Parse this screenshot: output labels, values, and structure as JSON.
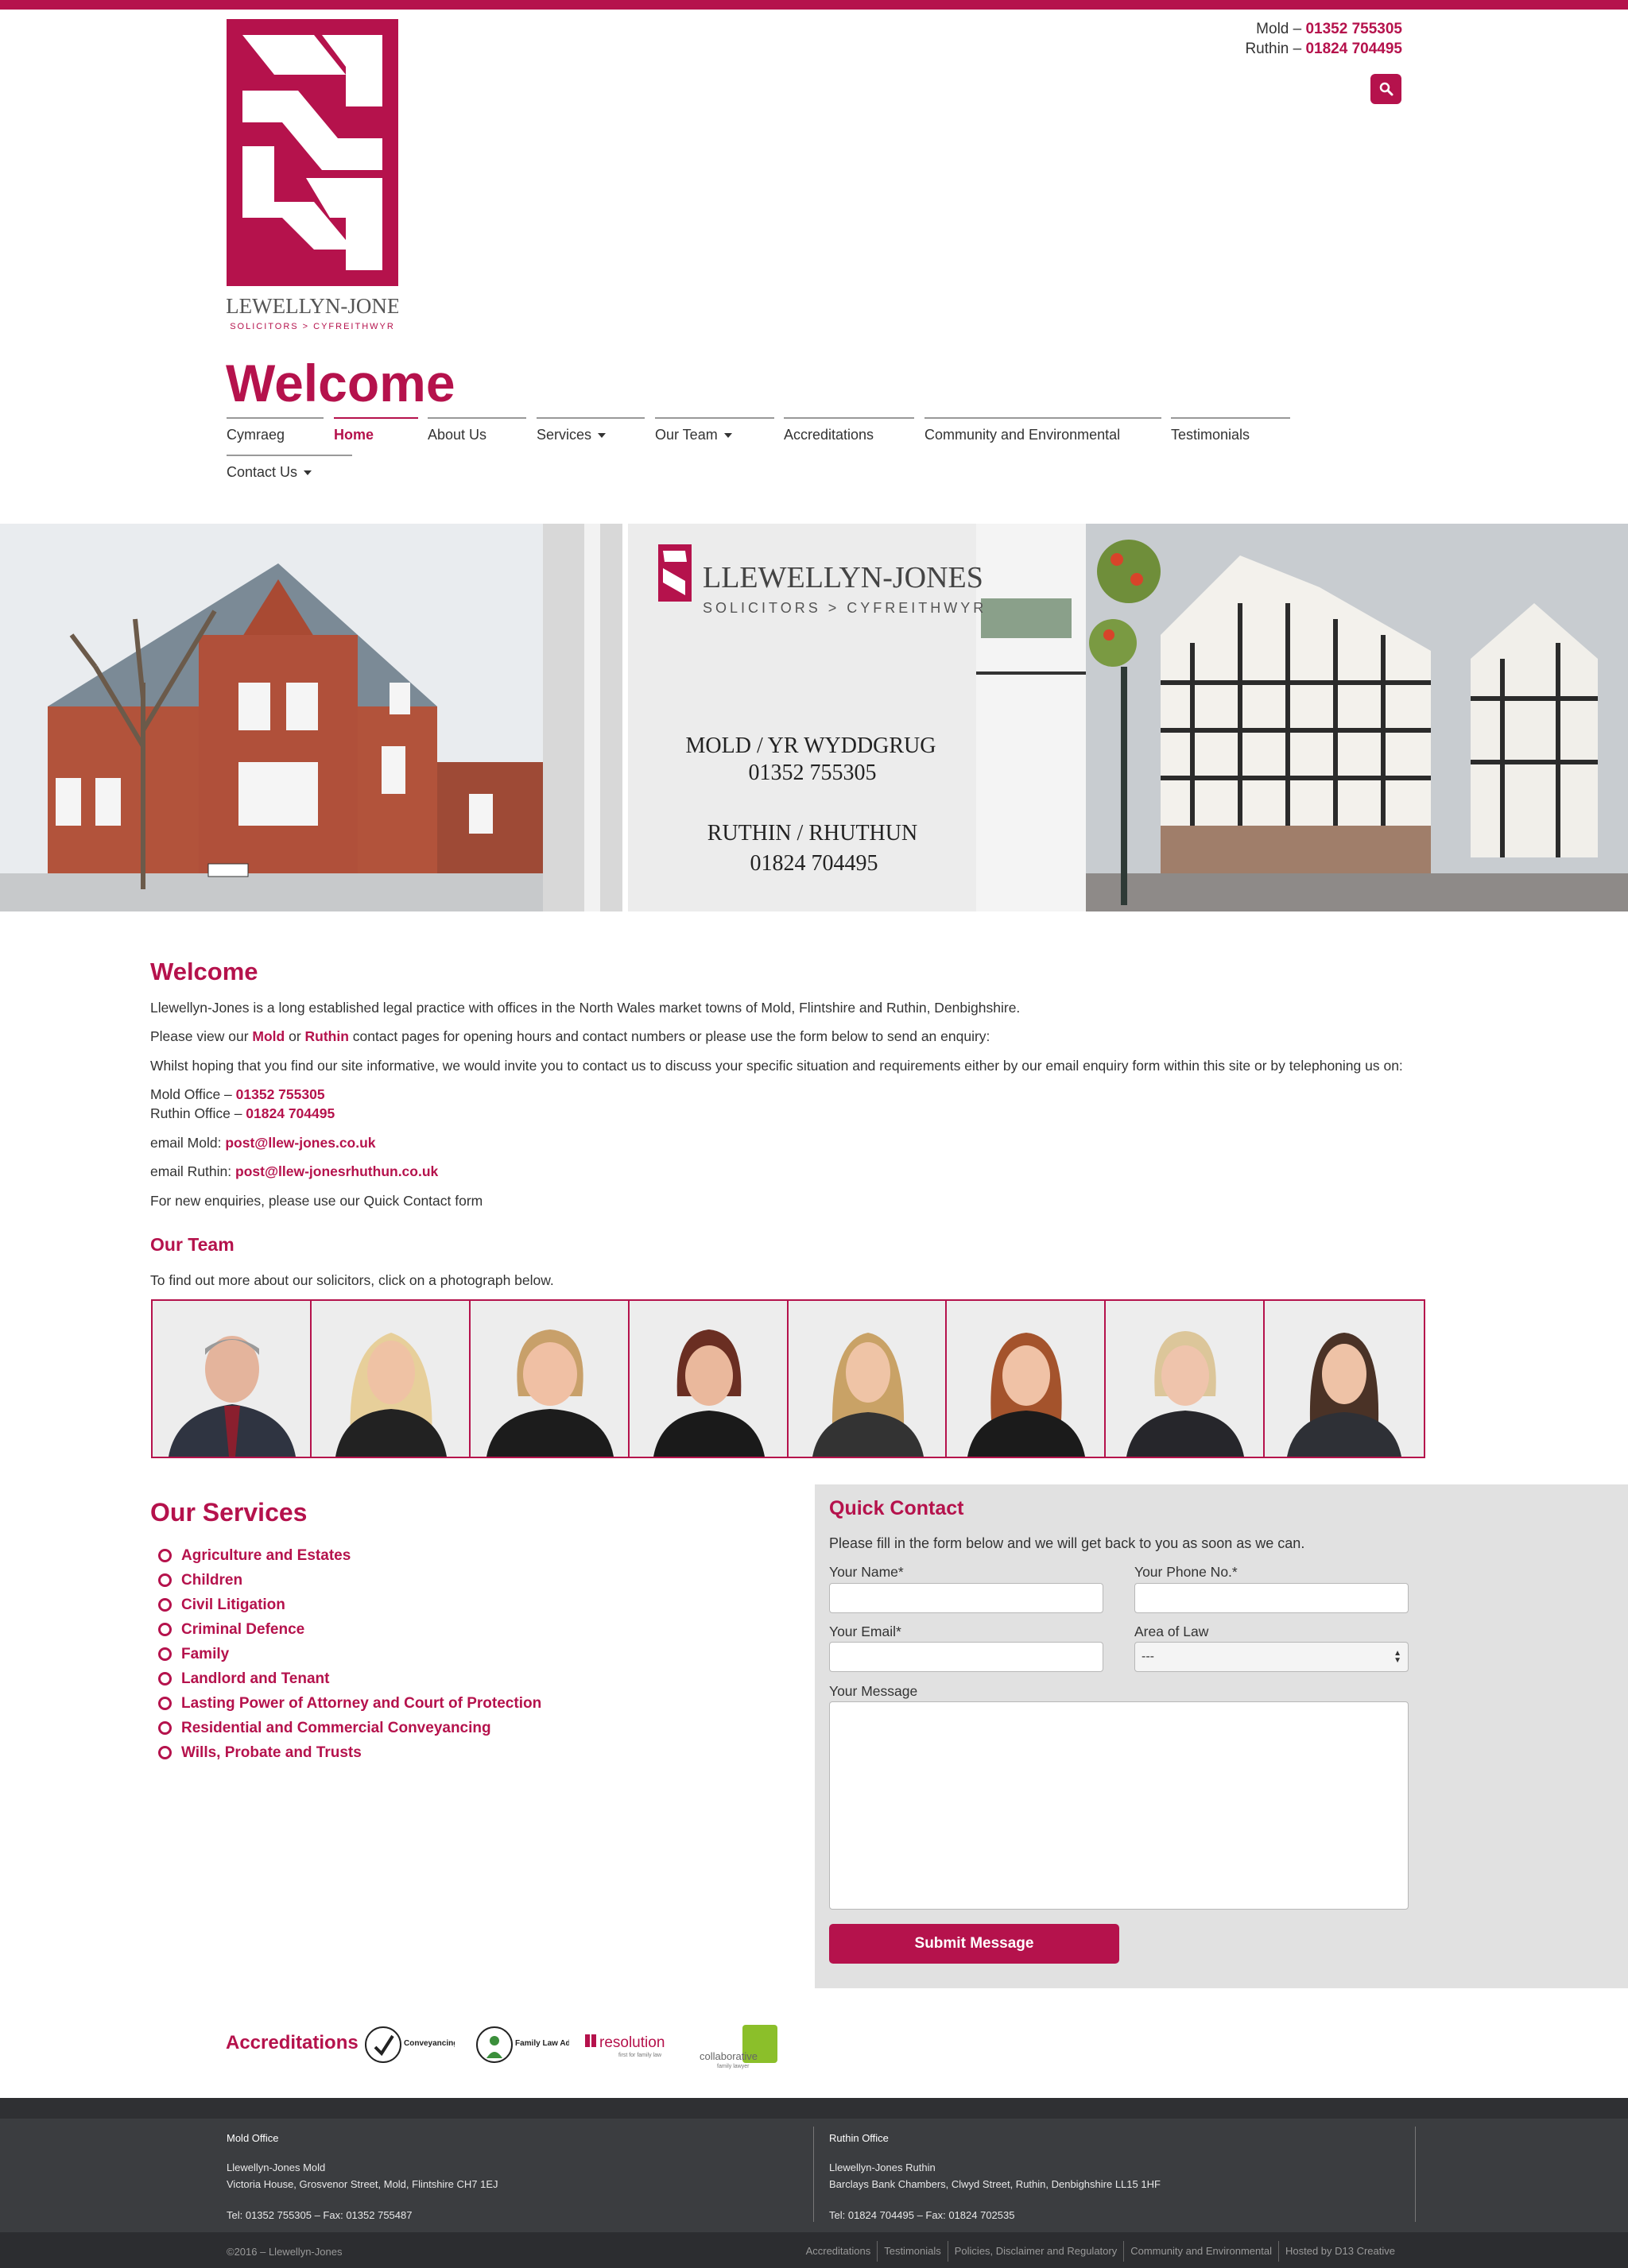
{
  "header": {
    "brand_name": "LLEWELLYN-JONES",
    "brand_tagline": "SOLICITORS > CYFREITHWYR",
    "phone_mold_label": "Mold – ",
    "phone_mold": "01352 755305",
    "phone_ruthin_label": "Ruthin – ",
    "phone_ruthin": "01824 704495",
    "page_title": "Welcome"
  },
  "nav": {
    "items": [
      "Cymraeg",
      "Home",
      "About Us",
      "Services",
      "Our Team",
      "Accreditations",
      "Community and Environmental",
      "Testimonials",
      "Contact Us"
    ],
    "active": "Home"
  },
  "hero": {
    "sign_brand": "LLEWELLYN-JONES",
    "sign_tagline": "SOLICITORS > CYFREITHWYR",
    "sign_mold": "MOLD / YR WYDDGRUG",
    "sign_mold_phone": "01352 755305",
    "sign_ruthin": "RUTHIN / RHUTHUN",
    "sign_ruthin_phone": "01824 704495"
  },
  "welcome": {
    "heading": "Welcome",
    "p1": "Llewellyn-Jones is a long established legal practice with offices in the North Wales market towns of Mold, Flintshire and Ruthin, Denbighshire.",
    "p2_before": "Please view our ",
    "p2_mold": "Mold",
    "p2_or": " or ",
    "p2_ruthin": "Ruthin",
    "p2_after": " contact pages for opening hours and contact numbers or please use the form below to send an enquiry:",
    "p3": "Whilst hoping that you find our site informative, we would invite you to contact us to discuss your specific situation and requirements either by our email enquiry form within this site or by telephoning us on:",
    "mold_office_label": "Mold Office – ",
    "mold_office_phone": "01352 755305",
    "ruthin_office_label": "Ruthin Office – ",
    "ruthin_office_phone": "01824 704495",
    "email_mold_label": "email Mold: ",
    "email_mold": "post@llew-jones.co.uk",
    "email_ruthin_label": "email Ruthin: ",
    "email_ruthin": "post@llew-jonesrhuthun.co.uk",
    "p_new": "For new enquiries, please use our Quick Contact form"
  },
  "team": {
    "heading": "Our Team",
    "intro": "To find out more about our solicitors, click on a photograph below.",
    "photo_count": 8
  },
  "services": {
    "heading": "Our Services",
    "items": [
      "Agriculture and Estates",
      "Children",
      "Civil Litigation",
      "Criminal Defence",
      "Family",
      "Landlord and Tenant",
      "Lasting Power of Attorney and Court of Protection",
      "Residential and Commercial Conveyancing",
      "Wills, Probate and Trusts"
    ]
  },
  "quick_contact": {
    "heading": "Quick Contact",
    "intro": "Please fill in the form below and we will get back to you as soon as we can.",
    "name_label": "Your Name*",
    "phone_label": "Your Phone No.*",
    "email_label": "Your Email*",
    "area_label": "Area of Law",
    "area_selected": "---",
    "message_label": "Your Message",
    "submit_label": "Submit Message"
  },
  "accreditations": {
    "heading": "Accreditations",
    "logos": [
      "Conveyancing Quality",
      "Family Law Advanced",
      "resolution",
      "collaborative"
    ],
    "resolution_tag": "first for family law",
    "collab_tag": "family lawyer"
  },
  "footer": {
    "mold_heading": "Mold Office",
    "mold_name": "Llewellyn-Jones Mold",
    "mold_address": "Victoria House, Grosvenor Street, Mold, Flintshire CH7 1EJ",
    "mold_tel": "Tel: 01352 755305 – Fax: 01352 755487",
    "ruthin_heading": "Ruthin Office",
    "ruthin_name": "Llewellyn-Jones Ruthin",
    "ruthin_address": "Barclays Bank Chambers, Clwyd Street, Ruthin, Denbighshire LL15 1HF",
    "ruthin_tel": "Tel: 01824 704495 – Fax: 01824 702535",
    "copyright": "©2016 – Llewellyn-Jones",
    "links": [
      "Accreditations",
      "Testimonials",
      "Policies, Disclaimer and Regulatory",
      "Community and Environmental",
      "Hosted by D13 Creative"
    ]
  },
  "colors": {
    "accent": "#b5124c",
    "footer_bg": "#3b3d40",
    "form_bg": "#e1e1e1"
  }
}
